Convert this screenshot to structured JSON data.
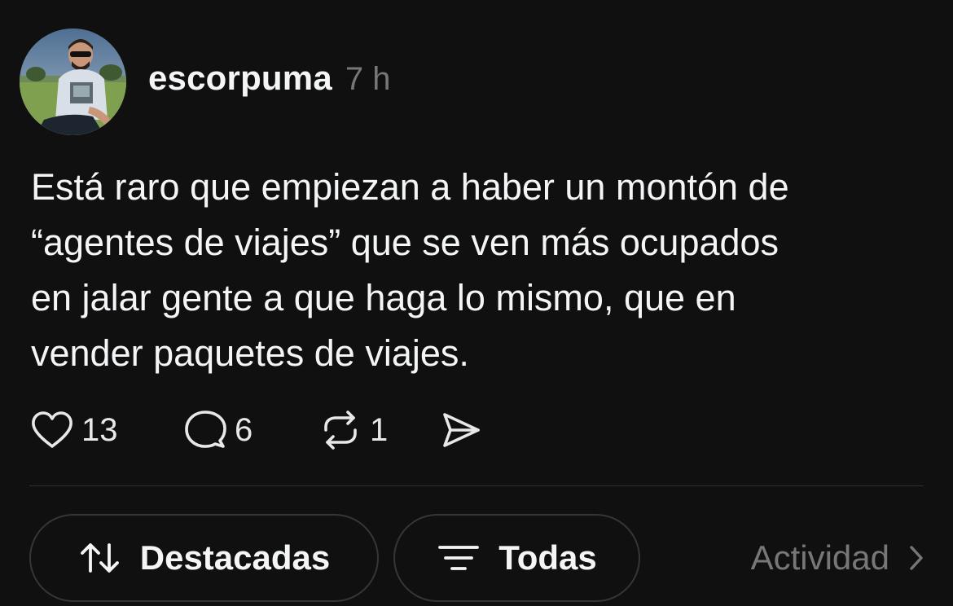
{
  "post": {
    "author": "escorpuma",
    "timestamp": "7 h",
    "text_lines": [
      "Está raro que empiezan a haber un montón de",
      "“agentes de viajes” que se ven más ocupados",
      "en jalar gente a que haga lo mismo, que en",
      "vender paquetes de viajes."
    ],
    "actions": {
      "like_icon": "heart-icon",
      "like_count": "13",
      "reply_icon": "comment-bubble-icon",
      "reply_count": "6",
      "repost_icon": "repost-arrows-icon",
      "repost_count": "1",
      "share_icon": "send-paper-plane-icon"
    }
  },
  "filters": {
    "featured_icon": "sort-arrows-icon",
    "featured_label": "Destacadas",
    "all_icon": "filter-lines-icon",
    "all_label": "Todas",
    "activity_label": "Actividad",
    "activity_icon": "chevron-right-icon"
  },
  "colors": {
    "background": "#101010",
    "text_primary": "#f3f5f7",
    "text_secondary": "#777777",
    "border": "#363636"
  }
}
